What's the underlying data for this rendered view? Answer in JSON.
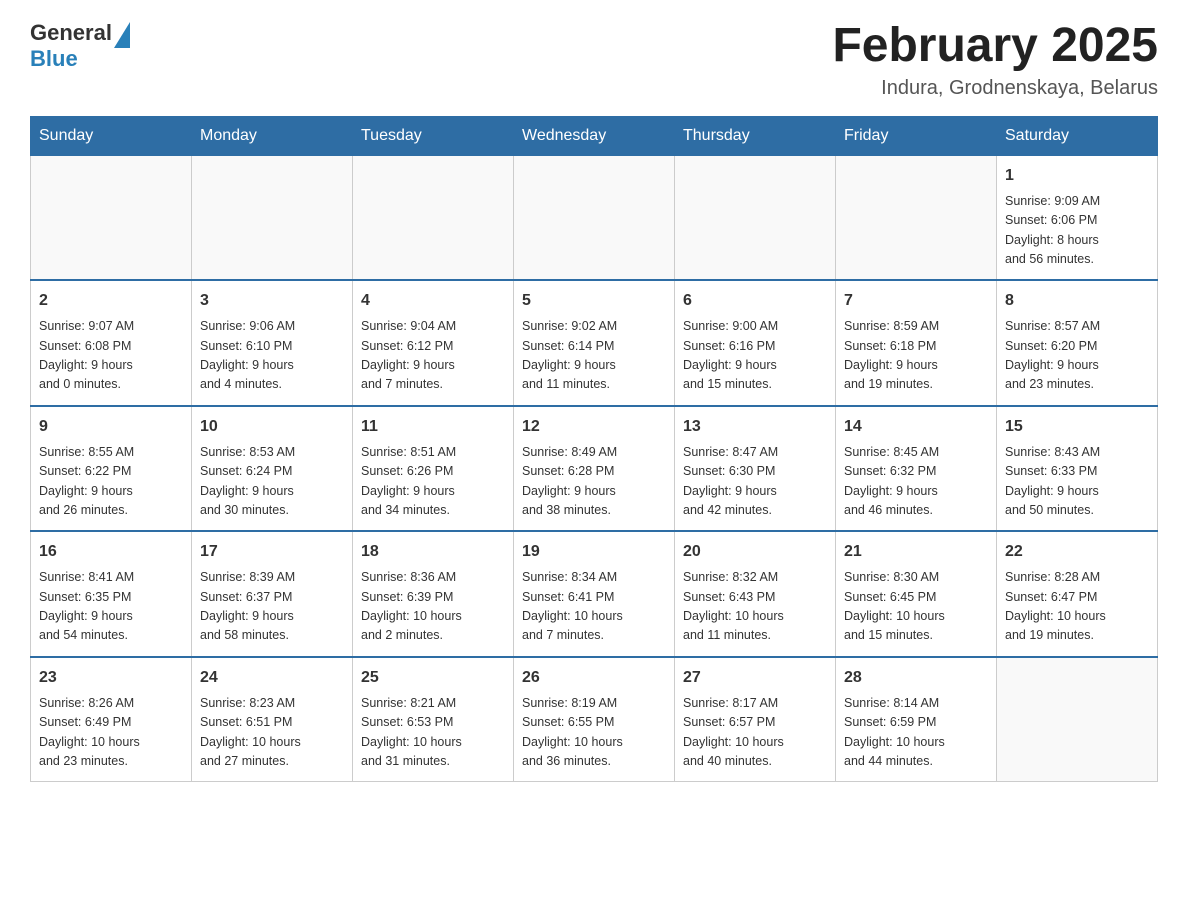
{
  "header": {
    "logo_general": "General",
    "logo_blue": "Blue",
    "month_title": "February 2025",
    "location": "Indura, Grodnenskaya, Belarus"
  },
  "weekdays": [
    "Sunday",
    "Monday",
    "Tuesday",
    "Wednesday",
    "Thursday",
    "Friday",
    "Saturday"
  ],
  "weeks": [
    [
      {
        "day": "",
        "info": ""
      },
      {
        "day": "",
        "info": ""
      },
      {
        "day": "",
        "info": ""
      },
      {
        "day": "",
        "info": ""
      },
      {
        "day": "",
        "info": ""
      },
      {
        "day": "",
        "info": ""
      },
      {
        "day": "1",
        "info": "Sunrise: 9:09 AM\nSunset: 6:06 PM\nDaylight: 8 hours\nand 56 minutes."
      }
    ],
    [
      {
        "day": "2",
        "info": "Sunrise: 9:07 AM\nSunset: 6:08 PM\nDaylight: 9 hours\nand 0 minutes."
      },
      {
        "day": "3",
        "info": "Sunrise: 9:06 AM\nSunset: 6:10 PM\nDaylight: 9 hours\nand 4 minutes."
      },
      {
        "day": "4",
        "info": "Sunrise: 9:04 AM\nSunset: 6:12 PM\nDaylight: 9 hours\nand 7 minutes."
      },
      {
        "day": "5",
        "info": "Sunrise: 9:02 AM\nSunset: 6:14 PM\nDaylight: 9 hours\nand 11 minutes."
      },
      {
        "day": "6",
        "info": "Sunrise: 9:00 AM\nSunset: 6:16 PM\nDaylight: 9 hours\nand 15 minutes."
      },
      {
        "day": "7",
        "info": "Sunrise: 8:59 AM\nSunset: 6:18 PM\nDaylight: 9 hours\nand 19 minutes."
      },
      {
        "day": "8",
        "info": "Sunrise: 8:57 AM\nSunset: 6:20 PM\nDaylight: 9 hours\nand 23 minutes."
      }
    ],
    [
      {
        "day": "9",
        "info": "Sunrise: 8:55 AM\nSunset: 6:22 PM\nDaylight: 9 hours\nand 26 minutes."
      },
      {
        "day": "10",
        "info": "Sunrise: 8:53 AM\nSunset: 6:24 PM\nDaylight: 9 hours\nand 30 minutes."
      },
      {
        "day": "11",
        "info": "Sunrise: 8:51 AM\nSunset: 6:26 PM\nDaylight: 9 hours\nand 34 minutes."
      },
      {
        "day": "12",
        "info": "Sunrise: 8:49 AM\nSunset: 6:28 PM\nDaylight: 9 hours\nand 38 minutes."
      },
      {
        "day": "13",
        "info": "Sunrise: 8:47 AM\nSunset: 6:30 PM\nDaylight: 9 hours\nand 42 minutes."
      },
      {
        "day": "14",
        "info": "Sunrise: 8:45 AM\nSunset: 6:32 PM\nDaylight: 9 hours\nand 46 minutes."
      },
      {
        "day": "15",
        "info": "Sunrise: 8:43 AM\nSunset: 6:33 PM\nDaylight: 9 hours\nand 50 minutes."
      }
    ],
    [
      {
        "day": "16",
        "info": "Sunrise: 8:41 AM\nSunset: 6:35 PM\nDaylight: 9 hours\nand 54 minutes."
      },
      {
        "day": "17",
        "info": "Sunrise: 8:39 AM\nSunset: 6:37 PM\nDaylight: 9 hours\nand 58 minutes."
      },
      {
        "day": "18",
        "info": "Sunrise: 8:36 AM\nSunset: 6:39 PM\nDaylight: 10 hours\nand 2 minutes."
      },
      {
        "day": "19",
        "info": "Sunrise: 8:34 AM\nSunset: 6:41 PM\nDaylight: 10 hours\nand 7 minutes."
      },
      {
        "day": "20",
        "info": "Sunrise: 8:32 AM\nSunset: 6:43 PM\nDaylight: 10 hours\nand 11 minutes."
      },
      {
        "day": "21",
        "info": "Sunrise: 8:30 AM\nSunset: 6:45 PM\nDaylight: 10 hours\nand 15 minutes."
      },
      {
        "day": "22",
        "info": "Sunrise: 8:28 AM\nSunset: 6:47 PM\nDaylight: 10 hours\nand 19 minutes."
      }
    ],
    [
      {
        "day": "23",
        "info": "Sunrise: 8:26 AM\nSunset: 6:49 PM\nDaylight: 10 hours\nand 23 minutes."
      },
      {
        "day": "24",
        "info": "Sunrise: 8:23 AM\nSunset: 6:51 PM\nDaylight: 10 hours\nand 27 minutes."
      },
      {
        "day": "25",
        "info": "Sunrise: 8:21 AM\nSunset: 6:53 PM\nDaylight: 10 hours\nand 31 minutes."
      },
      {
        "day": "26",
        "info": "Sunrise: 8:19 AM\nSunset: 6:55 PM\nDaylight: 10 hours\nand 36 minutes."
      },
      {
        "day": "27",
        "info": "Sunrise: 8:17 AM\nSunset: 6:57 PM\nDaylight: 10 hours\nand 40 minutes."
      },
      {
        "day": "28",
        "info": "Sunrise: 8:14 AM\nSunset: 6:59 PM\nDaylight: 10 hours\nand 44 minutes."
      },
      {
        "day": "",
        "info": ""
      }
    ]
  ]
}
